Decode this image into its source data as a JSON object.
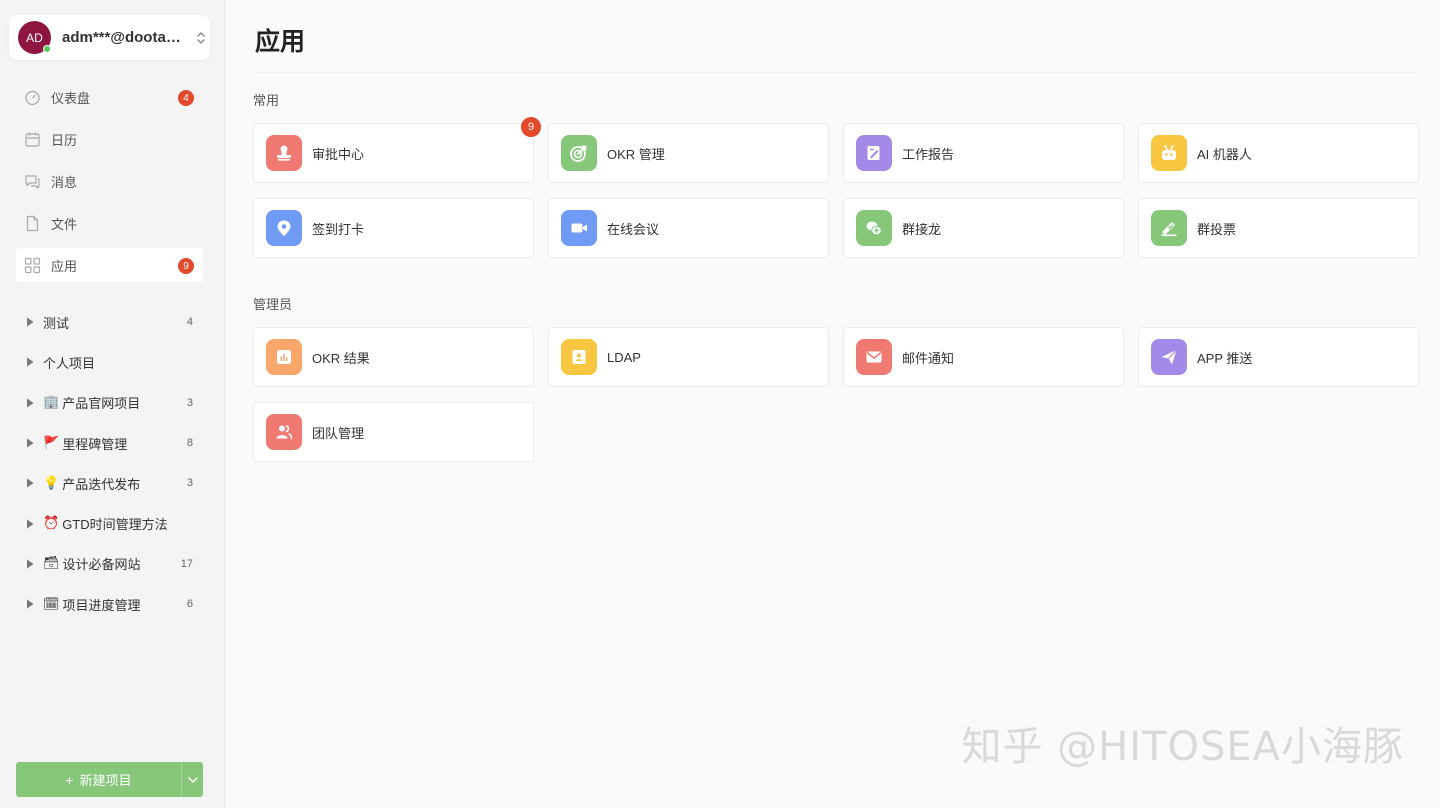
{
  "user": {
    "initials": "AD",
    "name": "adm***@dootask.com",
    "avatar_color": "#8e1640"
  },
  "nav": [
    {
      "label": "仪表盘",
      "icon": "dashboard-icon",
      "badge": "4"
    },
    {
      "label": "日历",
      "icon": "calendar-icon",
      "badge": ""
    },
    {
      "label": "消息",
      "icon": "message-icon",
      "badge": ""
    },
    {
      "label": "文件",
      "icon": "file-icon",
      "badge": ""
    },
    {
      "label": "应用",
      "icon": "apps-icon",
      "badge": "9",
      "active": true
    }
  ],
  "projects": [
    {
      "emoji": "",
      "name": "测试",
      "count": "4"
    },
    {
      "emoji": "",
      "name": "个人项目",
      "count": ""
    },
    {
      "emoji": "🏢",
      "name": "产品官网项目",
      "count": "3"
    },
    {
      "emoji": "🚩",
      "name": "里程碑管理",
      "count": "8"
    },
    {
      "emoji": "💡",
      "name": "产品迭代发布",
      "count": "3"
    },
    {
      "emoji": "⏰",
      "name": "GTD时间管理方法",
      "count": ""
    },
    {
      "emoji": "🗃",
      "name": "设计必备网站",
      "count": "17"
    },
    {
      "emoji": "🗓",
      "name": "项目进度管理",
      "count": "6"
    }
  ],
  "new_project": {
    "label": "新建项目",
    "plus": "+"
  },
  "page_title": "应用",
  "sections": {
    "common": {
      "title": "常用",
      "apps": [
        {
          "label": "审批中心",
          "icon": "approval-stamp-icon",
          "color": "#f07a72",
          "badge": "9"
        },
        {
          "label": "OKR 管理",
          "icon": "target-icon",
          "color": "#86c77a",
          "badge": ""
        },
        {
          "label": "工作报告",
          "icon": "report-edit-icon",
          "color": "#a38ae8",
          "badge": ""
        },
        {
          "label": "AI 机器人",
          "icon": "robot-icon",
          "color": "#f7c741",
          "badge": ""
        },
        {
          "label": "签到打卡",
          "icon": "location-pin-icon",
          "color": "#6f9bf5",
          "badge": ""
        },
        {
          "label": "在线会议",
          "icon": "video-camera-icon",
          "color": "#6f9bf5",
          "badge": ""
        },
        {
          "label": "群接龙",
          "icon": "group-chain-icon",
          "color": "#86c77a",
          "badge": ""
        },
        {
          "label": "群投票",
          "icon": "vote-icon",
          "color": "#86c77a",
          "badge": ""
        }
      ]
    },
    "admin": {
      "title": "管理员",
      "apps": [
        {
          "label": "OKR 结果",
          "icon": "bar-chart-icon",
          "color": "#f9a66b",
          "badge": ""
        },
        {
          "label": "LDAP",
          "icon": "directory-icon",
          "color": "#f7c741",
          "badge": ""
        },
        {
          "label": "邮件通知",
          "icon": "mail-icon",
          "color": "#f07a72",
          "badge": ""
        },
        {
          "label": "APP 推送",
          "icon": "send-plane-icon",
          "color": "#a38ae8",
          "badge": ""
        },
        {
          "label": "团队管理",
          "icon": "team-icon",
          "color": "#f07a72",
          "badge": ""
        }
      ]
    }
  },
  "watermark": "知乎 @HITOSEA小海豚"
}
